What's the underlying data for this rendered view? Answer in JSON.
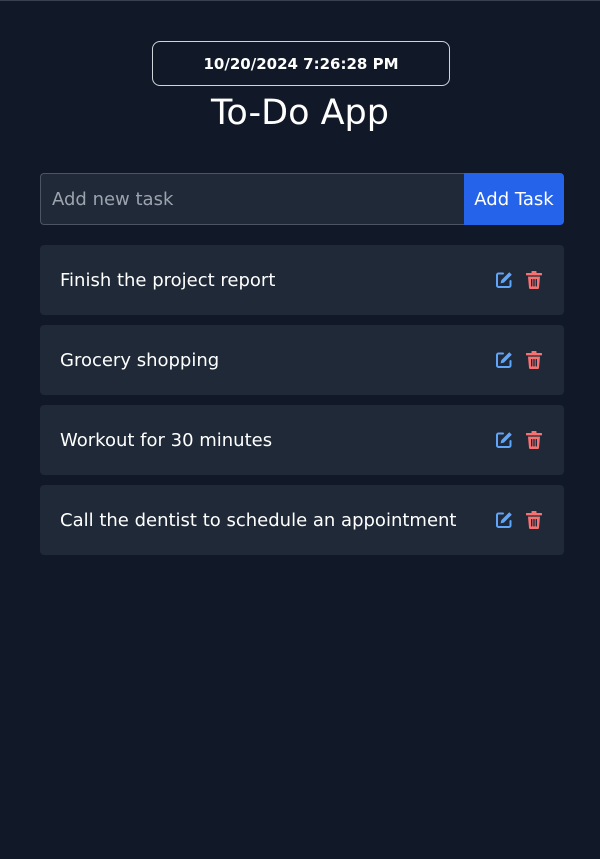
{
  "app": {
    "datetime": "10/20/2024 7:26:28 PM",
    "title": "To-Do App"
  },
  "form": {
    "placeholder": "Add new task",
    "value": "",
    "add_label": "Add Task"
  },
  "tasks": [
    {
      "text": "Finish the project report",
      "actions": [
        "edit-icon",
        "trash-icon"
      ]
    },
    {
      "text": "Grocery shopping",
      "actions": [
        "edit-icon",
        "trash-icon"
      ]
    },
    {
      "text": "Workout for 30 minutes",
      "actions": [
        "edit-icon",
        "trash-icon"
      ]
    },
    {
      "text": "Call the dentist to schedule an appointment",
      "actions": [
        "edit-icon",
        "trash-icon"
      ]
    }
  ],
  "colors": {
    "background": "#111827",
    "card": "#1f2937",
    "accent": "#2563eb",
    "edit_icon": "#60a5fa",
    "delete_icon": "#f87171"
  }
}
